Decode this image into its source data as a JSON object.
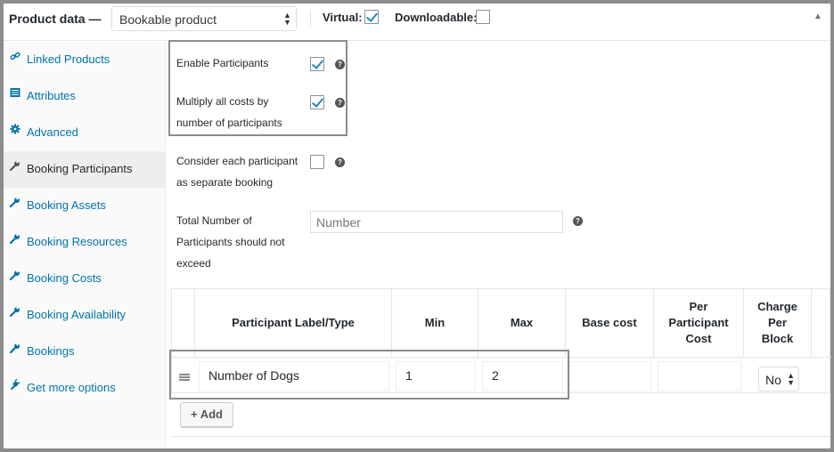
{
  "header": {
    "title": "Product data —",
    "product_type": "Bookable product",
    "virtual_label": "Virtual:",
    "virtual_checked": true,
    "downloadable_label": "Downloadable:",
    "downloadable_checked": false,
    "toggle_icon": "triangle-up-icon"
  },
  "sidebar": {
    "items": [
      {
        "label": "Linked Products",
        "icon": "link-icon",
        "active": false
      },
      {
        "label": "Attributes",
        "icon": "list-icon",
        "active": false
      },
      {
        "label": "Advanced",
        "icon": "gear-icon",
        "active": false
      },
      {
        "label": "Booking Participants",
        "icon": "wrench-icon",
        "active": true
      },
      {
        "label": "Booking Assets",
        "icon": "wrench-icon",
        "active": false
      },
      {
        "label": "Booking Resources",
        "icon": "wrench-icon",
        "active": false
      },
      {
        "label": "Booking Costs",
        "icon": "wrench-icon",
        "active": false
      },
      {
        "label": "Booking Availability",
        "icon": "wrench-icon",
        "active": false
      },
      {
        "label": "Bookings",
        "icon": "wrench-icon",
        "active": false
      },
      {
        "label": "Get more options",
        "icon": "plug-icon",
        "active": false
      }
    ]
  },
  "fields": {
    "enable_participants": {
      "label": "Enable Participants",
      "checked": true
    },
    "multiply_costs": {
      "label_1": "Multiply all costs by",
      "label_2": "number of participants",
      "checked": true
    },
    "separate_booking": {
      "label_1": "Consider each participant",
      "label_2": "as separate booking",
      "checked": false
    },
    "total_participants": {
      "label_1": "Total Number of",
      "label_2": "Participants should not",
      "label_3": "exceed",
      "placeholder": "Number",
      "value": ""
    },
    "help_glyph": "?"
  },
  "table": {
    "columns": [
      {
        "label": ""
      },
      {
        "label": "Participant Label/Type"
      },
      {
        "label": "Min"
      },
      {
        "label": "Max"
      },
      {
        "label": "Base cost"
      },
      {
        "label": "Per Participant Cost"
      },
      {
        "label": "Charge Per Block"
      }
    ],
    "rows": [
      {
        "label": "Number of Dogs",
        "min": "1",
        "max": "2",
        "base_cost": "",
        "per_participant_cost": "",
        "charge_per_block": "No"
      }
    ],
    "add_button": "+ Add"
  },
  "colors": {
    "link": "#0073aa",
    "check": "#1e8cbe",
    "highlight_border": "#8c8c8c"
  }
}
